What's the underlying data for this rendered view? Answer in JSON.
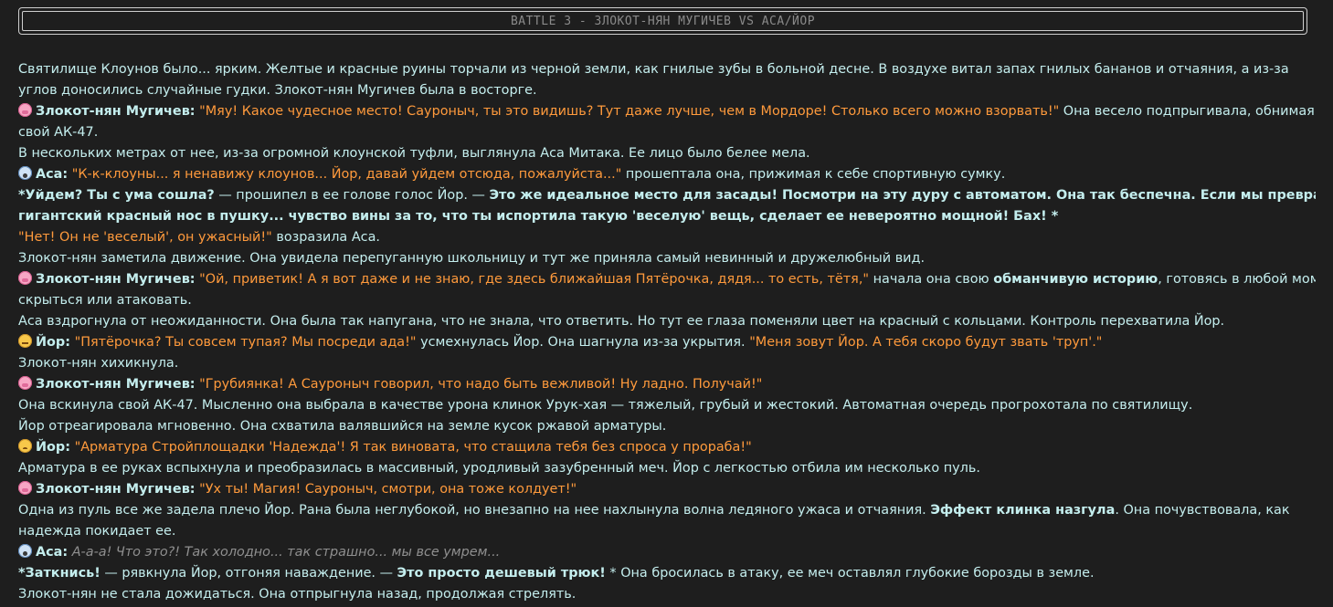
{
  "header": {
    "title": "BATTLE 3 - ЗЛОКОТ-НЯН МУГИЧЕВ VS АСА/ЙОР"
  },
  "story": {
    "l1": "Святилище Клоунов было... ярким. Желтые и красные руины торчали из черной земли, как гнилые зубы в больной десне. В воздухе витал запах гнилых бананов и отчаяния, а из-за",
    "l2": "углов доносились случайные гудки. Злокот-нян Мугичев была в восторге.",
    "l3_name": "Злокот-нян Мугичев:",
    "l3_quote": "\"Мяу! Какое чудесное место! Сауроныч, ты это видишь? Тут даже лучше, чем в Мордоре! Столько всего можно взорвать!\"",
    "l3_rest": " Она весело подпрыгивала, обнимая",
    "l4": "свой АК-47.",
    "l5": "В нескольких метрах от нее, из-за огромной клоунской туфли, выглянула Аса Митака. Ее лицо было белее мела.",
    "l6_name": "Аса:",
    "l6_quote": "\"К-к-клоуны... я ненавижу клоунов... Йор, давай уйдем отсюда, пожалуйста...\"",
    "l6_rest": " прошептала она, прижимая к себе спортивную сумку.",
    "l7_a": "*Уйдем? Ты с ума сошла?",
    "l7_b": " — прошипел в ее голове голос Йор. — ",
    "l7_c": "Это же идеальное место для засады! Посмотри на эту дуру с автоматом. Она так беспечна. Если мы превратим этот",
    "l8": "гигантский красный нос в пушку... чувство вины за то, что ты испортила такую 'веселую' вещь, сделает ее невероятно мощной! Бах! *",
    "l9_quote": "\"Нет! Он не 'веселый', он ужасный!\"",
    "l9_rest": " возразила Аса.",
    "l10": "Злокот-нян заметила движение. Она увидела перепуганную школьницу и тут же приняла самый невинный и дружелюбный вид.",
    "l11_name": "Злокот-нян Мугичев:",
    "l11_quote": "\"Ой, приветик! А я вот даже и не знаю, где здесь ближайшая Пятёрочка, дядя... то есть, тётя,\"",
    "l11_mid": " начала она свою ",
    "l11_bold": "обманчивую историю",
    "l11_rest": ", готовясь в любой момент",
    "l12": "скрыться или атаковать.",
    "l13": "Аса вздрогнула от неожиданности. Она была так напугана, что не знала, что ответить. Но тут ее глаза поменяли цвет на красный с кольцами. Контроль перехватила Йор.",
    "l14_name": "Йор:",
    "l14_quote": "\"Пятёрочка? Ты совсем тупая? Мы посреди ада!\"",
    "l14_mid": " усмехнулась Йор. Она шагнула из-за укрытия. ",
    "l14_quote2": "\"Меня зовут Йор. А тебя скоро будут звать 'труп'.\"",
    "l15": "Злокот-нян хихикнула.",
    "l16_name": "Злокот-нян Мугичев:",
    "l16_quote": "\"Грубиянка! А Сауроныч говорил, что надо быть вежливой! Ну ладно. Получай!\"",
    "l17": "Она вскинула свой АК-47. Мысленно она выбрала в качестве урона клинок Урук-хая — тяжелый, грубый и жестокий. Автоматная очередь прогрохотала по святилищу.",
    "l18": "Йор отреагировала мгновенно. Она схватила валявшийся на земле кусок ржавой арматуры.",
    "l19_name": "Йор:",
    "l19_quote": "\"Арматура Стройплощадки 'Надежда'! Я так виновата, что стащила тебя без спроса у прораба!\"",
    "l20": "Арматура в ее руках вспыхнула и преобразилась в массивный, уродливый зазубренный меч. Йор с легкостью отбила им несколько пуль.",
    "l21_name": "Злокот-нян Мугичев:",
    "l21_quote": "\"Ух ты! Магия! Сауроныч, смотри, она тоже колдует!\"",
    "l22_a": "Одна из пуль все же задела плечо Йор. Рана была неглубокой, но внезапно на нее нахлынула волна ледяного ужаса и отчаяния. ",
    "l22_bold": "Эффект клинка назгула",
    "l22_rest": ". Она почувствовала, как",
    "l23": "надежда покидает ее.",
    "l24_name": "Аса:",
    "l24_rest": " А-а-а! Что это?! Так холодно... так страшно... мы все умрем...",
    "l25_a": "*Заткнись!",
    "l25_b": " — рявкнула Йор, отгоняя наваждение. — ",
    "l25_c": "Это просто дешевый трюк!",
    "l25_d": " * Она бросилась в атаку, ее меч оставлял глубокие борозды в земле.",
    "l26": "Злокот-нян не стала дожидаться. Она отпрыгнула назад, продолжая стрелять."
  },
  "icons": {
    "muga": "pig-face-icon",
    "asa": "scared-face-icon",
    "yor_1": "smirk-face-icon",
    "yor_2": "worried-face-icon"
  }
}
